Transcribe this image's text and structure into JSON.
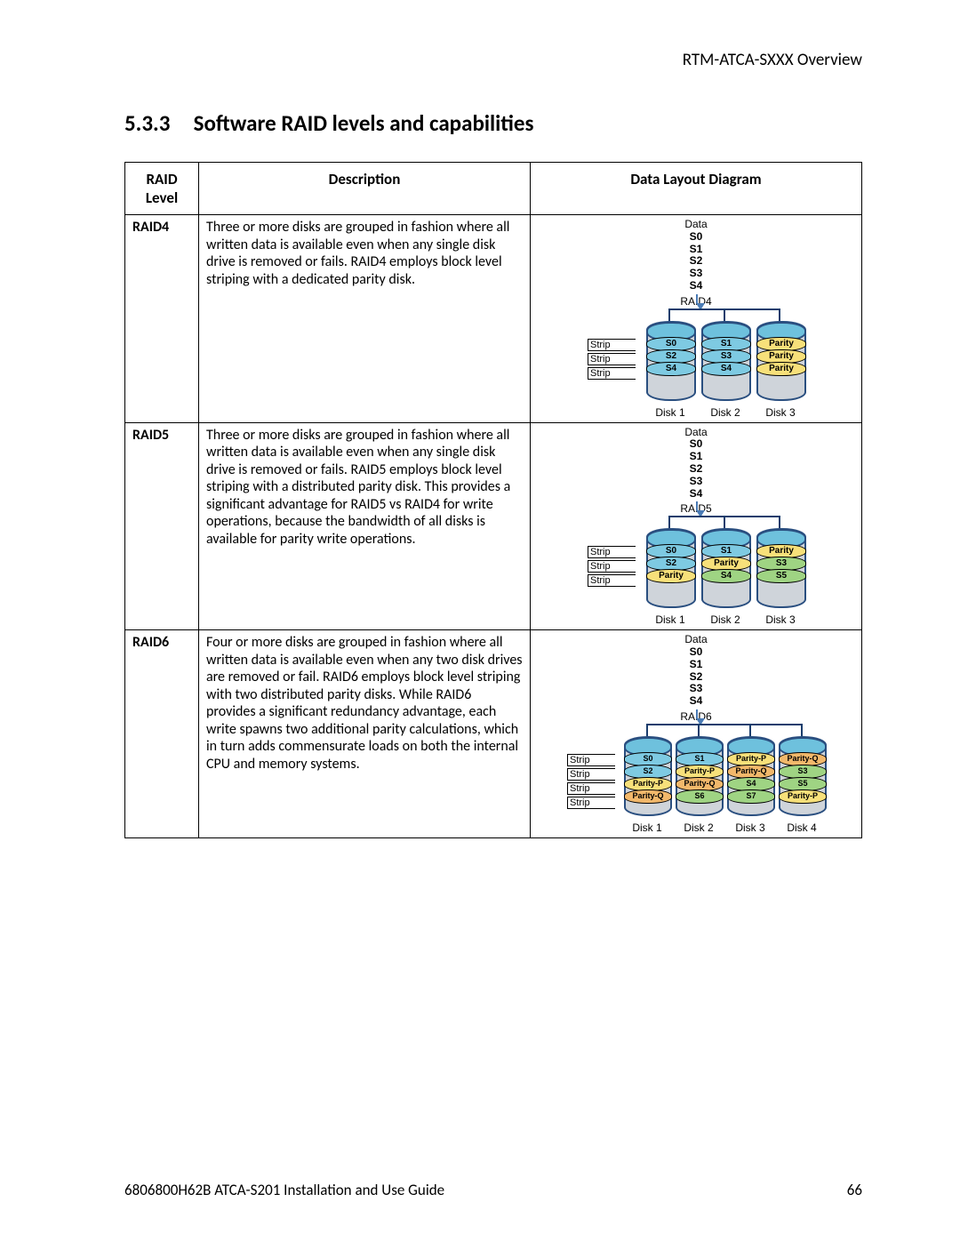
{
  "header": "RTM-ATCA-SXXX Overview",
  "section": {
    "num": "5.3.3",
    "title": "Software RAID levels and capabilities"
  },
  "columns": {
    "c1": "RAID Level",
    "c2": "Description",
    "c3": "Data Layout Diagram"
  },
  "footer": {
    "left": "6806800H62B ATCA-S201 Installation and Use Guide",
    "right": "66"
  },
  "common": {
    "data_label": "Data",
    "stripe_label": "Stripe",
    "segments": [
      "S0",
      "S1",
      "S2",
      "S3",
      "S4"
    ]
  },
  "rows": [
    {
      "level": "RAID4",
      "desc": "Three or more disks are grouped in fashion where all written data is available even when any single disk drive is removed or fails.  RAID4 employs block level striping with a dedicated parity disk.",
      "diagram": {
        "raid_label": "RAID4",
        "stripe_count": 3,
        "disks": [
          {
            "name": "Disk 1",
            "bands": [
              {
                "t": "S0",
                "c": "blue"
              },
              {
                "t": "S2",
                "c": "blue"
              },
              {
                "t": "S4",
                "c": "blue"
              }
            ]
          },
          {
            "name": "Disk 2",
            "bands": [
              {
                "t": "S1",
                "c": "blue"
              },
              {
                "t": "S3",
                "c": "blue"
              },
              {
                "t": "S4",
                "c": "blue"
              }
            ]
          },
          {
            "name": "Disk 3",
            "bands": [
              {
                "t": "Parity",
                "c": "yellow"
              },
              {
                "t": "Parity",
                "c": "yellow"
              },
              {
                "t": "Parity",
                "c": "yellow"
              }
            ]
          }
        ]
      }
    },
    {
      "level": "RAID5",
      "desc": "Three or more disks are grouped in fashion where all written data is available even when any single disk drive is removed or fails.  RAID5 employs block level striping with a distributed parity disk.  This provides a significant advantage for RAID5 vs RAID4 for write operations, because the bandwidth of all disks is available for parity write operations.",
      "diagram": {
        "raid_label": "RAID5",
        "stripe_count": 3,
        "disks": [
          {
            "name": "Disk 1",
            "bands": [
              {
                "t": "S0",
                "c": "blue"
              },
              {
                "t": "S2",
                "c": "blue"
              },
              {
                "t": "Parity",
                "c": "yellow"
              }
            ]
          },
          {
            "name": "Disk 2",
            "bands": [
              {
                "t": "S1",
                "c": "blue"
              },
              {
                "t": "Parity",
                "c": "yellow"
              },
              {
                "t": "S4",
                "c": "green"
              }
            ]
          },
          {
            "name": "Disk 3",
            "bands": [
              {
                "t": "Parity",
                "c": "yellow"
              },
              {
                "t": "S3",
                "c": "green"
              },
              {
                "t": "S5",
                "c": "green"
              }
            ]
          }
        ]
      }
    },
    {
      "level": "RAID6",
      "desc": "Four or more disks are grouped in fashion where all written data is available even when any two disk drives are removed or fail.  RAID6 employs block level striping with two distributed parity disks. While RAID6 provides a significant redundancy advantage, each write spawns two additional parity calculations, which in turn adds commensurate loads on both the internal CPU and memory systems.",
      "diagram": {
        "raid_label": "RAID6",
        "stripe_count": 4,
        "disks": [
          {
            "name": "Disk 1",
            "bands": [
              {
                "t": "S0",
                "c": "blue"
              },
              {
                "t": "S2",
                "c": "blue"
              },
              {
                "t": "Parity-P",
                "c": "yellow"
              },
              {
                "t": "Parity-Q",
                "c": "orange"
              }
            ]
          },
          {
            "name": "Disk 2",
            "bands": [
              {
                "t": "S1",
                "c": "blue"
              },
              {
                "t": "Parity-P",
                "c": "yellow"
              },
              {
                "t": "Parity-Q",
                "c": "orange"
              },
              {
                "t": "S6",
                "c": "green"
              }
            ]
          },
          {
            "name": "Disk 3",
            "bands": [
              {
                "t": "Parity-P",
                "c": "yellow"
              },
              {
                "t": "Parity-Q",
                "c": "orange"
              },
              {
                "t": "S4",
                "c": "green"
              },
              {
                "t": "S7",
                "c": "green"
              }
            ]
          },
          {
            "name": "Disk 4",
            "bands": [
              {
                "t": "Parity-Q",
                "c": "orange"
              },
              {
                "t": "S3",
                "c": "green"
              },
              {
                "t": "S5",
                "c": "green"
              },
              {
                "t": "Parity-P",
                "c": "yellow"
              }
            ]
          }
        ]
      }
    }
  ]
}
